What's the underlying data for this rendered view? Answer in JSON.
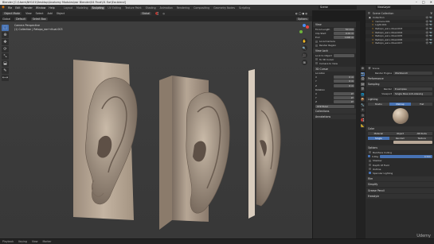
{
  "window": {
    "title": "Blender [C:\\Users\\NH101\\Desktop\\Anatomy Modules\\ear Blender\\04 Final\\01 Ear\\Ear.blend]",
    "controls": [
      "–",
      "□",
      "✕"
    ]
  },
  "menubar": {
    "items": [
      "File",
      "Edit",
      "Render",
      "Window",
      "Help"
    ],
    "workspaces": [
      "Layout",
      "Modeling",
      "Sculpting",
      "UV Editing",
      "Texture Paint",
      "Shading",
      "Animation",
      "Rendering",
      "Compositing",
      "Geometry Nodes",
      "Scripting"
    ],
    "active_workspace": "Sculpting",
    "scene": "Scene",
    "view_layer": "ViewLayer"
  },
  "header": {
    "mode": "Object Mode",
    "menus": [
      "View",
      "Select",
      "Add",
      "Object"
    ],
    "orientation": "Global",
    "transform": "Global",
    "drag": "Default",
    "select_box": "Select Box",
    "options": "Options"
  },
  "viewport": {
    "view_name": "Camera Perspective",
    "collection_info": "(1) Collection | Retopo_ear+ritual.003"
  },
  "toolbar": {
    "icons": [
      "select-box-icon",
      "cursor-icon",
      "move-icon",
      "rotate-icon",
      "scale-icon",
      "transform-icon",
      "annotate-icon",
      "measure-icon"
    ],
    "glyphs": [
      "⬚",
      "⊕",
      "✥",
      "⟳",
      "⤡",
      "⬓",
      "✎",
      "⟷"
    ]
  },
  "nav_gizmo": [
    "✋",
    "🔍",
    "🎥",
    "⊞"
  ],
  "npanel": {
    "view_section": "View",
    "focal_length_label": "Focal Length",
    "focal_length": "50 mm",
    "clip_start_label": "Clip Start",
    "clip_start": "0.01 m",
    "clip_end_label": "End",
    "clip_end": "1000 m",
    "local_camera_label": "Local Camera",
    "render_region": "Render Region",
    "view_lock": "View Lock",
    "lock_to_object": "Lock to Object",
    "lock_3d_cursor": "To 3D Cursor",
    "camera_to_view": "Camera to View",
    "cursor_section": "3D Cursor",
    "location_label": "Location",
    "x_label": "X",
    "x": "0 m",
    "y_label": "Y",
    "y": "0 m",
    "z_label": "Z",
    "z": "0 m",
    "rotation_label": "Rotation",
    "rx": "0°",
    "ry": "0°",
    "rz": "0°",
    "rotation_mode": "XYZ Euler",
    "collections": "Collections",
    "annotations": "Annotations",
    "tabs": [
      "Item",
      "Tool",
      "View"
    ]
  },
  "outliner": {
    "search": "Scene Collection",
    "rows": [
      {
        "name": "Collection",
        "indent": 1
      },
      {
        "name": "Camera.001",
        "indent": 2
      },
      {
        "name": "Light.001",
        "indent": 2
      },
      {
        "name": "Retopo_ear+ritual.003",
        "indent": 2
      },
      {
        "name": "Retopo_ear+ritual.004",
        "indent": 2
      },
      {
        "name": "Retopo_ear+ritual.005",
        "indent": 2
      },
      {
        "name": "Retopo_ear+ritual.006",
        "indent": 2
      },
      {
        "name": "Retopo_ear+ritual.007",
        "indent": 2
      }
    ]
  },
  "properties": {
    "search": "Scene",
    "render_engine_label": "Render Engine",
    "render_engine": "Workbench",
    "performance": "Performance",
    "sampling": "Sampling",
    "render_label": "Render",
    "render_value": "8 samples",
    "viewport_label": "Viewport",
    "viewport_value": "Single Pass Anti-Aliasing",
    "lighting": "Lighting",
    "lighting_modes": [
      "Studio",
      "Matcap",
      "Flat"
    ],
    "lighting_active": "Matcap",
    "color": "Color",
    "color_modes": [
      "Material",
      "Object",
      "Attribute",
      "Single",
      "Random",
      "Texture"
    ],
    "color_active": "Single",
    "options": "Options",
    "backface_culling": "Backface Culling",
    "xray": "X-Ray",
    "xray_value": "0.500",
    "shadow": "Shadow",
    "depth_of_field": "Depth Of Field",
    "outline": "Outline",
    "specular": "Specular Lighting",
    "film": "Film",
    "simplify": "Simplify",
    "grease_pencil": "Grease Pencil",
    "freestyle": "Freestyle",
    "tab_glyphs": [
      "⚙",
      "📷",
      "🖨",
      "🖼",
      "🎬",
      "🌐",
      "📦",
      "🔧",
      "⚛",
      "◎",
      "🧲",
      "📐"
    ],
    "tab_active_index": 1
  },
  "timeline": {
    "items": [
      "Playback",
      "Keying",
      "View",
      "Marker"
    ]
  },
  "watermark": "Udemy",
  "colors": {
    "accent": "#4772b3",
    "model_clay": "#b8a898"
  }
}
